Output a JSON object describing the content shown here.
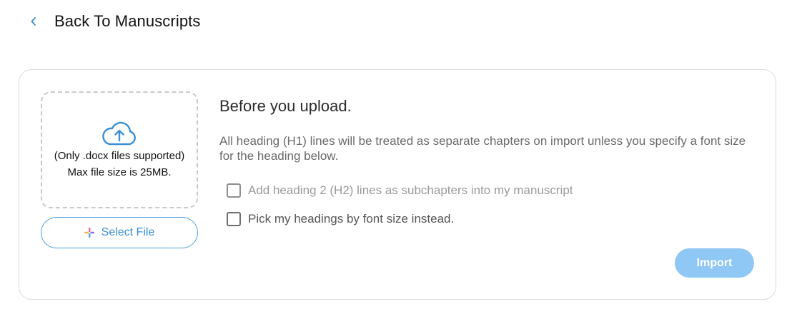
{
  "header": {
    "back_label": "Back To Manuscripts",
    "back_icon": "chevron-left-icon"
  },
  "upload": {
    "icon": "cloud-upload-icon",
    "supported_text": "(Only .docx files supported)",
    "max_size_text": "Max file size is 25MB.",
    "select_label": "Select File",
    "select_icon": "plus-icon"
  },
  "info": {
    "title": "Before you upload.",
    "description": "All heading (H1) lines will be treated as separate chapters on import unless you specify a font size for the heading below."
  },
  "options": [
    {
      "label": "Add heading 2 (H2) lines as subchapters into my manuscript",
      "checked": false,
      "disabled": true
    },
    {
      "label": "Pick my headings by font size instead.",
      "checked": false,
      "disabled": false
    }
  ],
  "actions": {
    "import_label": "Import",
    "import_disabled": true
  },
  "colors": {
    "accent": "#3a8fd6",
    "import_disabled_bg": "#8fc7f5"
  }
}
